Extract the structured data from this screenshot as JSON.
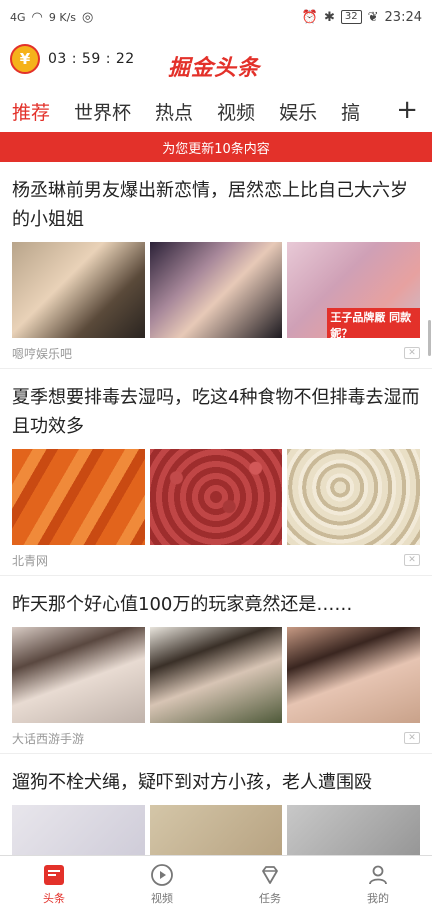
{
  "status_bar": {
    "signal": "4G",
    "speed": "9 K/s",
    "battery": "32",
    "time": "23:24"
  },
  "header": {
    "timer": "03 : 59 : 22",
    "logo": "掘金头条",
    "coin_symbol": "¥"
  },
  "tabs": [
    "推荐",
    "世界杯",
    "热点",
    "视频",
    "娱乐",
    "搞"
  ],
  "tab_add": "+",
  "banner": "为您更新10条内容",
  "articles": [
    {
      "title": "杨丞琳前男友爆出新恋情，居然恋上比自己大六岁的小姐姐",
      "source": "嗯哼娱乐吧",
      "overlay": "王子品牌厰 同款鈮？"
    },
    {
      "title": "夏季想要排毒去湿吗，吃这4种食物不但排毒去湿而且功效多",
      "source": "北青网"
    },
    {
      "title": "昨天那个好心值100万的玩家竟然还是……",
      "source": "大话西游手游"
    },
    {
      "title": "遛狗不栓犬绳，疑吓到对方小孩，老人遭围殴",
      "source": ""
    }
  ],
  "bottom_nav": [
    {
      "label": "头条",
      "icon": "headline-icon"
    },
    {
      "label": "视频",
      "icon": "play-icon"
    },
    {
      "label": "任务",
      "icon": "diamond-icon"
    },
    {
      "label": "我的",
      "icon": "person-icon"
    }
  ],
  "colors": {
    "accent": "#e3312a"
  }
}
